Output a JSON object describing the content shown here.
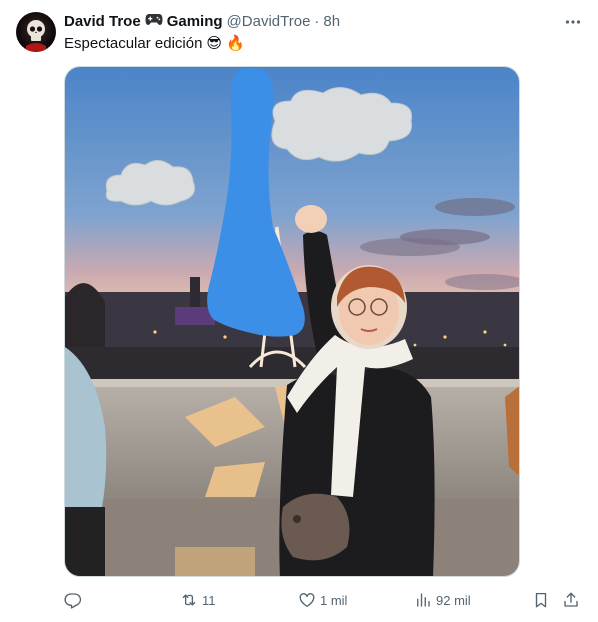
{
  "tweet": {
    "display_name": "David Troe",
    "display_name_suffix": "Gaming",
    "gamepad_emoji": "🎮",
    "handle": "@DavidTroe",
    "separator": "·",
    "time": "8h",
    "text": "Espectacular edición",
    "emojis": [
      "😎",
      "🔥"
    ],
    "image_alt": "Photo of a person in front of the Eiffel Tower at dusk with hand-drawn blue tower and cartoon clouds"
  },
  "actions": {
    "reply": {
      "icon": "reply-icon",
      "count": ""
    },
    "retweet": {
      "icon": "retweet-icon",
      "count": "11"
    },
    "like": {
      "icon": "heart-icon",
      "count": "1 mil"
    },
    "views": {
      "icon": "views-icon",
      "count": "92 mil"
    },
    "bookmark": {
      "icon": "bookmark-icon"
    },
    "share": {
      "icon": "share-icon"
    }
  },
  "colors": {
    "text_primary": "#0f1419",
    "text_secondary": "#536471",
    "border": "#cfd9de",
    "paint_blue": "#3b8fe6",
    "cloud_grey": "#d9dde0"
  }
}
